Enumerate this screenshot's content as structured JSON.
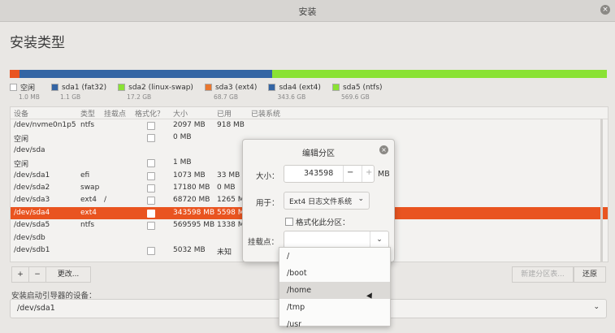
{
  "window": {
    "title": "安装",
    "close_icon": "×"
  },
  "page_title": "安装类型",
  "partition_bar": [
    {
      "color": "#e95420",
      "fraction": 0.016
    },
    {
      "color": "#3465a4",
      "fraction": 0.423
    },
    {
      "color": "#8ae234",
      "fraction": 0.561
    }
  ],
  "legend": [
    {
      "label": "空闲",
      "size": "1.0 MB",
      "color": "#ffffff"
    },
    {
      "label": "sda1 (fat32)",
      "size": "1.1 GB",
      "color": "#3465a4"
    },
    {
      "label": "sda2 (linux-swap)",
      "size": "17.2 GB",
      "color": "#8ae234"
    },
    {
      "label": "sda3 (ext4)",
      "size": "68.7 GB",
      "color": "#e9772f"
    },
    {
      "label": "sda4 (ext4)",
      "size": "343.6 GB",
      "color": "#3465a4"
    },
    {
      "label": "sda5 (ntfs)",
      "size": "569.6 GB",
      "color": "#8ae234"
    }
  ],
  "table": {
    "headers": {
      "device": "设备",
      "type": "类型",
      "mount": "挂载点",
      "format": "格式化？",
      "size": "大小",
      "used": "已用",
      "installed": "已装系统"
    },
    "rows": [
      {
        "device": "/dev/nvme0n1p5",
        "type": "ntfs",
        "mount": "",
        "check": true,
        "size": "2097 MB",
        "used": "918 MB"
      },
      {
        "device": "空闲",
        "type": "",
        "mount": "",
        "check": true,
        "size": "0 MB",
        "used": ""
      },
      {
        "device": "/dev/sda",
        "type": "",
        "mount": "",
        "check": false,
        "size": "",
        "used": ""
      },
      {
        "device": "空闲",
        "type": "",
        "mount": "",
        "check": true,
        "size": "1 MB",
        "used": ""
      },
      {
        "device": "/dev/sda1",
        "type": "efi",
        "mount": "",
        "check": true,
        "size": "1073 MB",
        "used": "33 MB"
      },
      {
        "device": "/dev/sda2",
        "type": "swap",
        "mount": "",
        "check": true,
        "size": "17180 MB",
        "used": "0 MB"
      },
      {
        "device": "/dev/sda3",
        "type": "ext4",
        "mount": "/",
        "check": true,
        "size": "68720 MB",
        "used": "1265 MB"
      },
      {
        "device": "/dev/sda4",
        "type": "ext4",
        "mount": "",
        "check": true,
        "size": "343598 MB",
        "used": "5598 MB",
        "selected": true
      },
      {
        "device": "/dev/sda5",
        "type": "ntfs",
        "mount": "",
        "check": true,
        "size": "569595 MB",
        "used": "1338 MB"
      },
      {
        "device": "/dev/sdb",
        "type": "",
        "mount": "",
        "check": false,
        "size": "",
        "used": ""
      },
      {
        "device": "/dev/sdb1",
        "type": "",
        "mount": "",
        "check": true,
        "size": "5032 MB",
        "used": "未知"
      }
    ]
  },
  "toolbar": {
    "add": "+",
    "remove": "−",
    "change": "更改...",
    "new_table": "新建分区表...",
    "revert": "还原"
  },
  "bootloader": {
    "label": "安装启动引导器的设备：",
    "value": "/dev/sda1"
  },
  "dialog": {
    "title": "编辑分区",
    "size_label": "大小：",
    "size_value": "343598",
    "size_minus": "−",
    "size_plus": "+",
    "size_unit": "MB",
    "use_label": "用于：",
    "use_value": "Ext4 日志文件系统",
    "format_label": "格式化此分区：",
    "mount_label": "挂载点："
  },
  "mount_menu": [
    "/",
    "/boot",
    "/home",
    "/tmp",
    "/usr"
  ]
}
